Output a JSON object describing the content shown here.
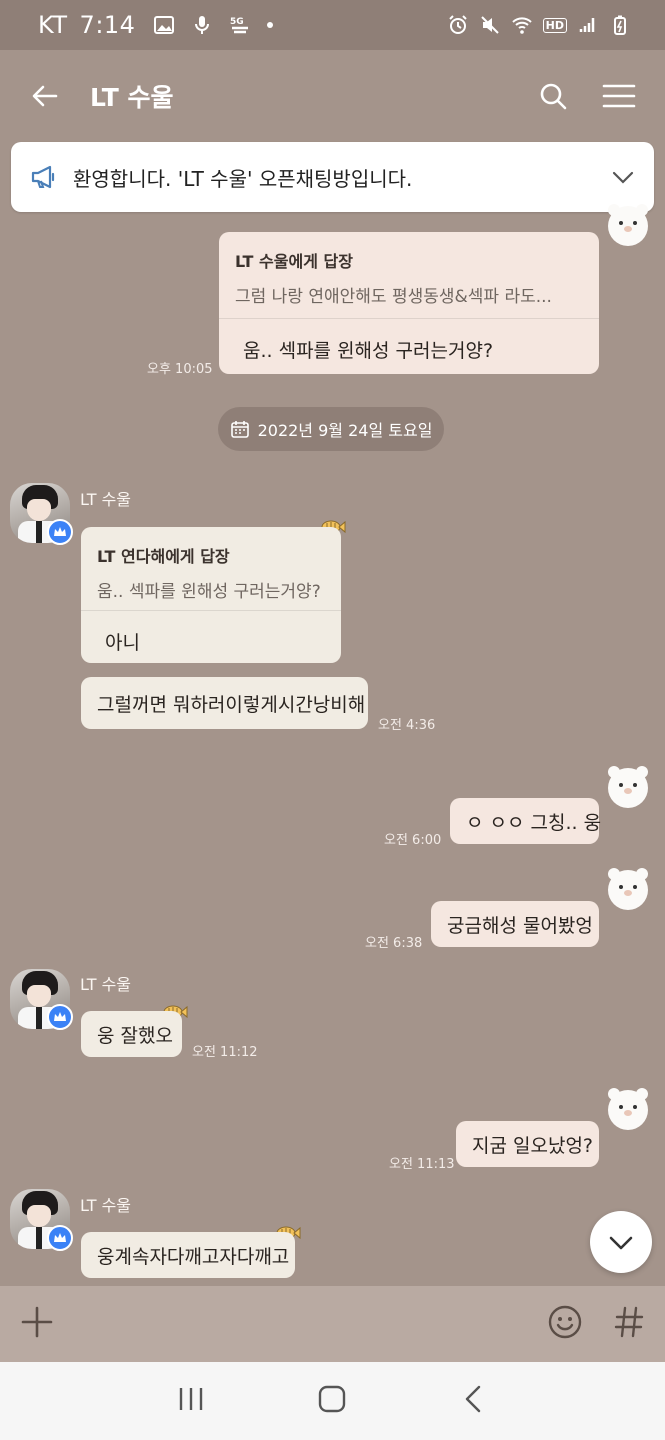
{
  "status_bar": {
    "carrier": "KT",
    "time": "7:14",
    "icons": [
      "gallery-icon",
      "mic-icon",
      "5g-signal-icon",
      "dot-icon",
      "alarm-icon",
      "mute-icon",
      "wifi-icon",
      "hd-icon",
      "signal-icon",
      "battery-icon"
    ],
    "hd_label": "HD"
  },
  "header": {
    "title": "LT 수울",
    "icons": [
      "back-arrow-icon",
      "search-icon",
      "menu-icon"
    ]
  },
  "notice": {
    "text": "환영합니다. 'LT 수울' 오픈채팅방입니다."
  },
  "messages": {
    "m1": {
      "reply_to": "LT 수울에게 답장",
      "quote": "그럼 나랑 연애안해도 평생동생&섹파 라도...",
      "text": "움.. 섹파를 윈해성 구러는거양?",
      "time": "오후 10:05"
    },
    "date_divider": "2022년 9월 24일 토요일",
    "m2": {
      "sender": "LT 수울",
      "reply_to": "LT 연다해에게 답장",
      "quote": "움.. 섹파를 윈해성 구러는거양?",
      "text": "아니"
    },
    "m3": {
      "text": "그럴꺼면 뭐하러이렇게시간낭비해",
      "time": "오전 4:36"
    },
    "m4": {
      "text": "ㅇ ㅇㅇ 그칭.. 웅",
      "time": "오전 6:00"
    },
    "m5": {
      "text": "궁금해성 물어봤엉",
      "time": "오전 6:38"
    },
    "m6": {
      "sender": "LT 수울",
      "text": "웅 잘했오",
      "time": "오전 11:12"
    },
    "m7": {
      "text": "지굼 일오났엉?",
      "time": "오전 11:13"
    },
    "m8": {
      "sender": "LT 수울",
      "text": "웅계속자다깨고자다깨고"
    }
  },
  "input_bar": {
    "icons": [
      "plus-icon",
      "emoji-icon",
      "hashtag-icon"
    ]
  },
  "nav_bar": {
    "icons": [
      "recent-apps-icon",
      "home-icon",
      "nav-back-icon"
    ]
  },
  "colors": {
    "background": "#a4948b",
    "status_bar": "#8f7f77",
    "incoming_bubble": "#f1ece3",
    "outgoing_bubble": "#f5e7e0",
    "input_bar": "#b9aaa2",
    "badge": "#3b82f6"
  }
}
